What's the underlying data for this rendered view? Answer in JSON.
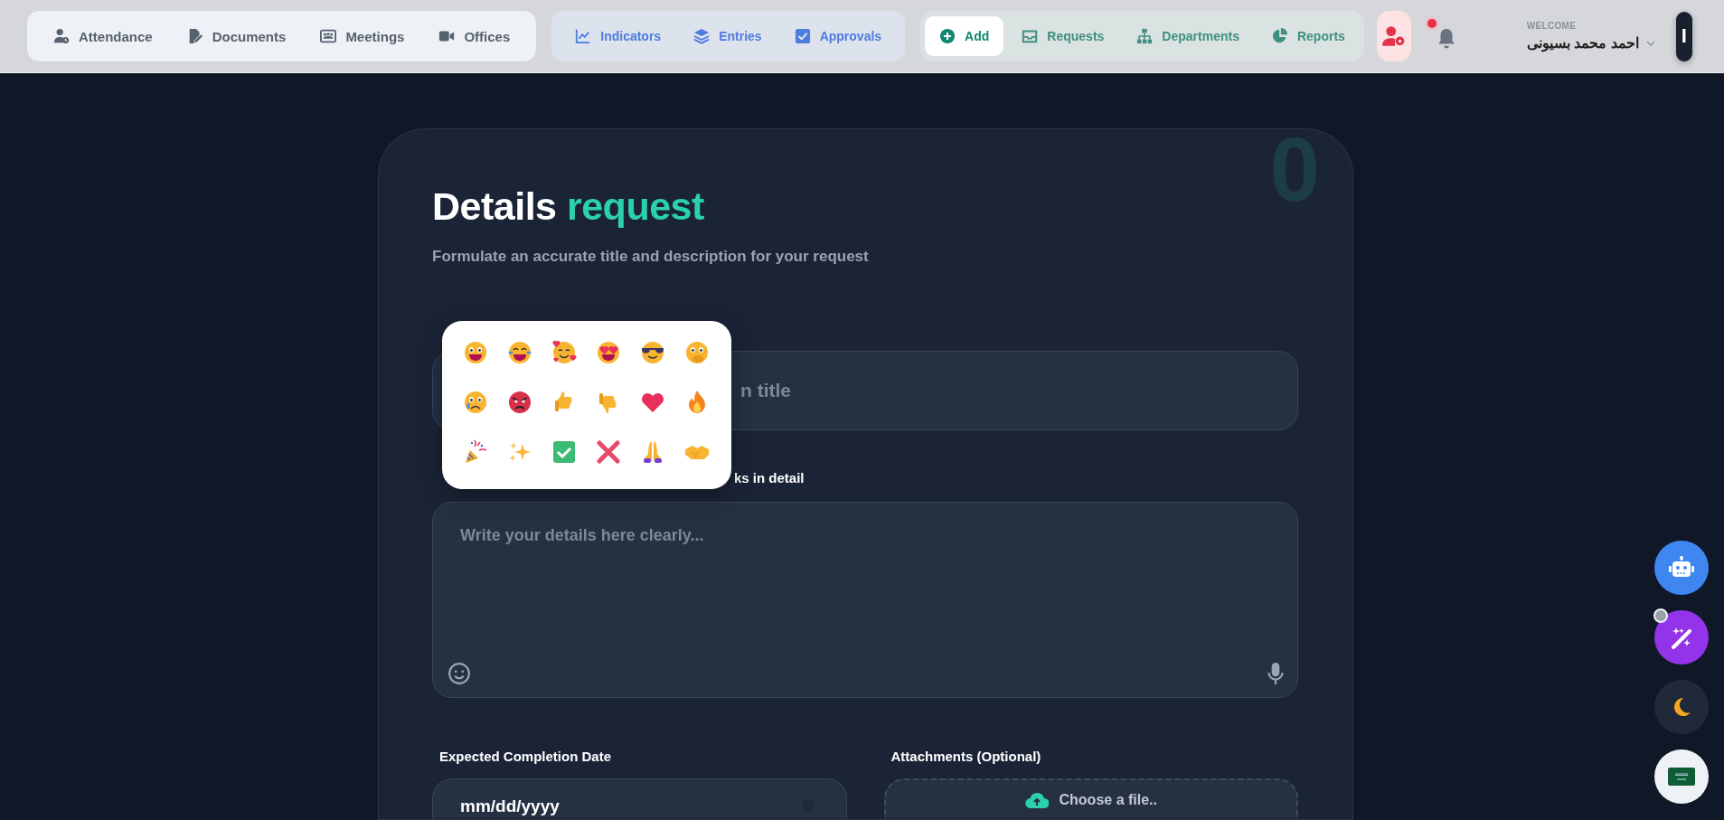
{
  "nav_groups": [
    {
      "items": [
        {
          "label": "Attendance",
          "selected": false
        },
        {
          "label": "Documents",
          "selected": false
        },
        {
          "label": "Meetings",
          "selected": false
        },
        {
          "label": "Offices",
          "selected": false
        }
      ]
    },
    {
      "items": [
        {
          "label": "Indicators",
          "selected": false
        },
        {
          "label": "Entries",
          "selected": false
        },
        {
          "label": "Approvals",
          "selected": false
        }
      ]
    },
    {
      "items": [
        {
          "label": "Add",
          "selected": true
        },
        {
          "label": "Requests",
          "selected": false
        },
        {
          "label": "Departments",
          "selected": false
        },
        {
          "label": "Reports",
          "selected": false
        }
      ]
    }
  ],
  "notifications": {
    "unread": true
  },
  "user": {
    "welcome": "WELCOME",
    "name": "احمد محمد بسيونى",
    "avatar_letter": "I"
  },
  "card": {
    "watermark": "0",
    "title": "Details",
    "title_accent": "request",
    "subtitle": "Formulate an accurate title and description for your request",
    "title_field": {
      "placeholder": "n title"
    },
    "details_label": "ks in detail",
    "details_field": {
      "placeholder": "Write your details here clearly..."
    },
    "date_label": "Expected Completion Date",
    "date_field": {
      "placeholder": "mm/dd/yyyy"
    },
    "attachments_label": "Attachments (Optional)",
    "attachment_button": "Choose a file.."
  },
  "emoji_picker": {
    "open": true
  },
  "assistant_badge": {
    "shown": true
  }
}
